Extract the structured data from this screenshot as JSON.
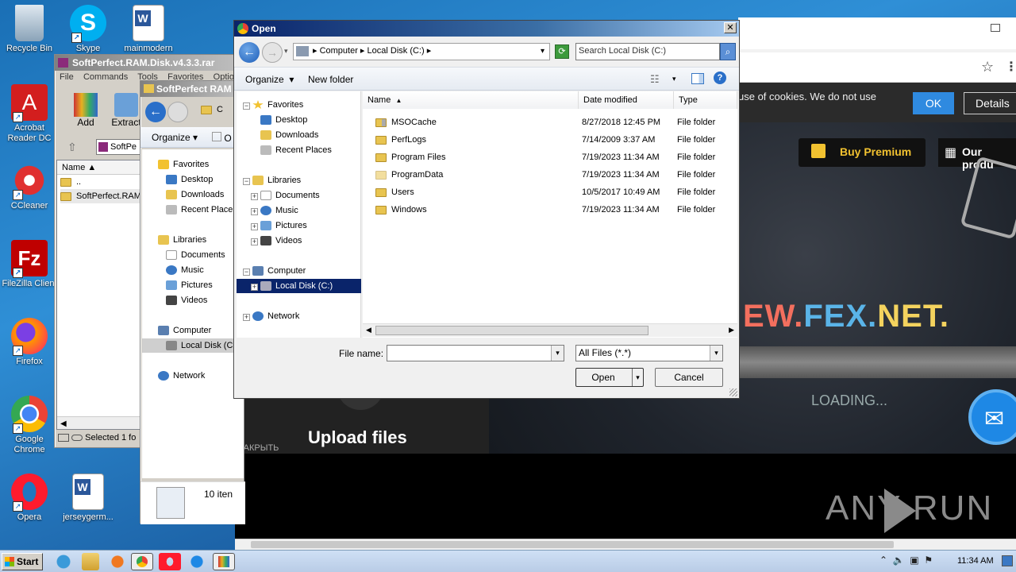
{
  "desktop": {
    "icons": [
      {
        "label": "Recycle Bin",
        "icon": "recycle-bin-icon"
      },
      {
        "label": "Skype",
        "icon": "skype-icon"
      },
      {
        "label": "mainmodern",
        "icon": "word-doc-icon"
      },
      {
        "label": "Acrobat Reader DC",
        "icon": "acrobat-icon"
      },
      {
        "label": "CCleaner",
        "icon": "ccleaner-icon"
      },
      {
        "label": "FileZilla Client",
        "icon": "filezilla-icon"
      },
      {
        "label": "Firefox",
        "icon": "firefox-icon"
      },
      {
        "label": "Google Chrome",
        "icon": "chrome-icon"
      },
      {
        "label": "Opera",
        "icon": "opera-icon"
      },
      {
        "label": "jerseygerm...",
        "icon": "word-doc-icon"
      }
    ]
  },
  "browser_bg": {
    "cookie_text": "use of cookies. We do not use",
    "ok": "OK",
    "details": "Details",
    "buy_premium": "Buy Premium",
    "our_products": "Our produ",
    "site_name_1": "EW.",
    "site_name_2": "FEX.",
    "site_name_3": "NET.",
    "loading": "LOADING...",
    "upload_files": "Upload files",
    "close_ru": "ЗАКРЫТЬ",
    "watermark": "ANY  RUN"
  },
  "winrar": {
    "title": "SoftPerfect.RAM.Disk.v4.3.3.rar",
    "menu": [
      "File",
      "Commands",
      "Tools",
      "Favorites",
      "Options"
    ],
    "add": "Add",
    "extract": "Extract",
    "path_text": "SoftPe",
    "col_name": "Name",
    "rows": [
      "..",
      "SoftPerfect.RAM"
    ],
    "status": "Selected 1 fo"
  },
  "explorer2": {
    "title": "SoftPerfect RAM",
    "organize": "Organize",
    "organize2": "O",
    "path": "C",
    "tree": [
      "Favorites",
      "Desktop",
      "Downloads",
      "Recent Places",
      "Libraries",
      "Documents",
      "Music",
      "Pictures",
      "Videos",
      "Computer",
      "Local Disk (C:",
      "Network"
    ],
    "items_count": "10 iten"
  },
  "dialog": {
    "title": "Open",
    "breadcrumb": [
      "Computer",
      "Local Disk (C:)"
    ],
    "search_placeholder": "Search Local Disk (C:)",
    "organize": "Organize",
    "new_folder": "New folder",
    "tree": {
      "favorites": "Favorites",
      "desktop": "Desktop",
      "downloads": "Downloads",
      "recent": "Recent Places",
      "libraries": "Libraries",
      "documents": "Documents",
      "music": "Music",
      "pictures": "Pictures",
      "videos": "Videos",
      "computer": "Computer",
      "local_disk": "Local Disk (C:)",
      "network": "Network"
    },
    "columns": {
      "name": "Name",
      "date": "Date modified",
      "type": "Type"
    },
    "files": [
      {
        "name": "MSOCache",
        "date": "8/27/2018 12:45 PM",
        "type": "File folder",
        "locked": true
      },
      {
        "name": "PerfLogs",
        "date": "7/14/2009 3:37 AM",
        "type": "File folder",
        "locked": false
      },
      {
        "name": "Program Files",
        "date": "7/19/2023 11:34 AM",
        "type": "File folder",
        "locked": false
      },
      {
        "name": "ProgramData",
        "date": "7/19/2023 11:34 AM",
        "type": "File folder",
        "locked": false
      },
      {
        "name": "Users",
        "date": "10/5/2017 10:49 AM",
        "type": "File folder",
        "locked": false
      },
      {
        "name": "Windows",
        "date": "7/19/2023 11:34 AM",
        "type": "File folder",
        "locked": false
      }
    ],
    "filename_label": "File name:",
    "filename_value": "",
    "filter": "All Files (*.*)",
    "open": "Open",
    "cancel": "Cancel"
  },
  "taskbar": {
    "start": "Start",
    "clock": "11:34 AM"
  },
  "colors": {
    "desktop_blue": "#1f77c0",
    "selection": "#0a246a",
    "ok_blue": "#2f8ae0",
    "premium_yellow": "#f2c230"
  }
}
